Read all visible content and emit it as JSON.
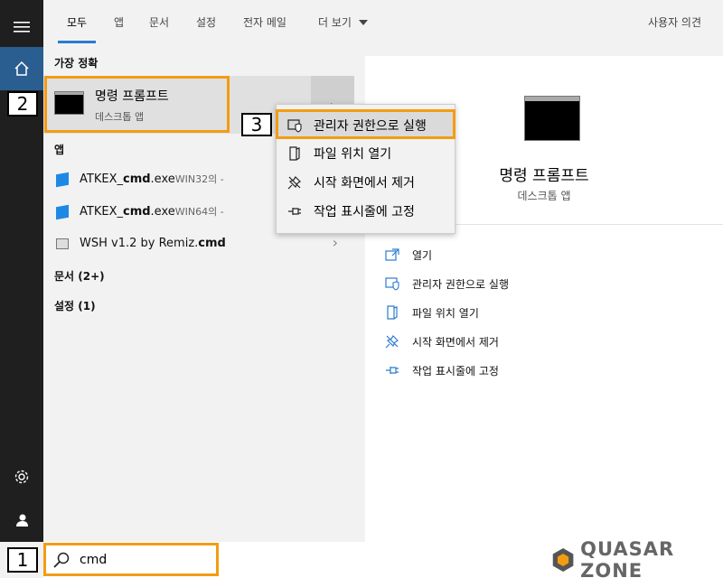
{
  "nav": {
    "tabs": [
      "모두",
      "앱",
      "문서",
      "설정",
      "전자 메일",
      "더 보기"
    ],
    "feedback": "사용자 의견"
  },
  "results": {
    "best_match_header": "가장 정확",
    "best_match": {
      "title": "명령 프롬프트",
      "subtitle": "데스크톱 앱"
    },
    "apps_header": "앱",
    "apps": [
      {
        "pre": "ATKEX_",
        "bold": "cmd",
        "post": ".exe",
        "suffix": "WIN32의 -"
      },
      {
        "pre": "ATKEX_",
        "bold": "cmd",
        "post": ".exe",
        "suffix": "WIN64의 -"
      },
      {
        "pre": "WSH v1.2 by Remiz.",
        "bold": "cmd",
        "post": "",
        "suffix": ""
      }
    ],
    "docs_header": "문서 (2+)",
    "settings_header": "설정 (1)"
  },
  "context_menu": {
    "items": [
      "관리자 권한으로 실행",
      "파일 위치 열기",
      "시작 화면에서 제거",
      "작업 표시줄에 고정"
    ]
  },
  "preview": {
    "title": "명령 프롬프트",
    "subtitle": "데스크톱 앱",
    "actions": [
      "열기",
      "관리자 권한으로 실행",
      "파일 위치 열기",
      "시작 화면에서 제거",
      "작업 표시줄에 고정"
    ]
  },
  "search": {
    "value": "cmd"
  },
  "annotations": {
    "n1": "1",
    "n2": "2",
    "n3": "3"
  },
  "watermark": {
    "text": "QUASAR ZONE"
  },
  "colors": {
    "accent": "#2b7bd0",
    "highlight": "#f39c12",
    "sidebar": "#1f1f1f",
    "home": "#2a5d90"
  },
  "icons": [
    "menu-icon",
    "home-icon",
    "settings-icon",
    "user-icon",
    "search-icon",
    "cmd-icon",
    "shield-icon",
    "folder-icon",
    "unpin-icon",
    "pin-icon",
    "open-icon"
  ]
}
